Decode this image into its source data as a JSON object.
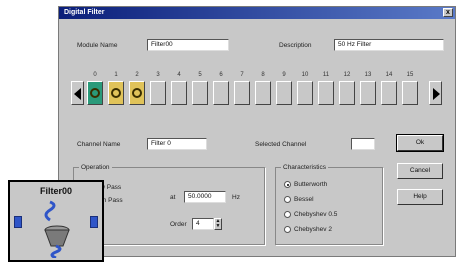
{
  "window": {
    "title": "Digital Filter",
    "close_glyph": "x"
  },
  "fields": {
    "module_name_label": "Module Name",
    "module_name_value": "Filter00",
    "description_label": "Description",
    "description_value": "50 Hz Filter",
    "channel_name_label": "Channel Name",
    "channel_name_value": "Filter 0",
    "selected_channel_label": "Selected Channel",
    "selected_channel_value": ""
  },
  "channels": {
    "numbers": [
      "0",
      "1",
      "2",
      "3",
      "4",
      "5",
      "6",
      "7",
      "8",
      "9",
      "10",
      "11",
      "12",
      "13",
      "14",
      "15"
    ],
    "selected_index": 0,
    "active_indices": [
      0,
      1,
      2
    ],
    "prev_icon": "arrow-left-icon",
    "next_icon": "arrow-right-icon"
  },
  "operation": {
    "title": "Operation",
    "low_pass_label": "Low Pass",
    "high_pass_label": "High Pass",
    "low_pass_checked": true,
    "at_label": "at",
    "frequency_value": "50.0000",
    "unit_label": "Hz",
    "order_label": "Order",
    "order_value": "4"
  },
  "characteristics": {
    "title": "Characteristics",
    "options": [
      "Butterworth",
      "Bessel",
      "Chebyshev 0.5",
      "Chebyshev 2"
    ],
    "selected_index": 0
  },
  "buttons": {
    "ok": "Ok",
    "cancel": "Cancel",
    "help": "Help"
  },
  "inset": {
    "title": "Filter00",
    "icon": "filter-module-icon"
  },
  "colors": {
    "title_bar": "#0b1f7a",
    "dialog_bg": "#c8c8c8",
    "selected_channel": "#2a9a7a",
    "active_channel": "#e0c35a",
    "node_blue": "#2f55c8"
  }
}
